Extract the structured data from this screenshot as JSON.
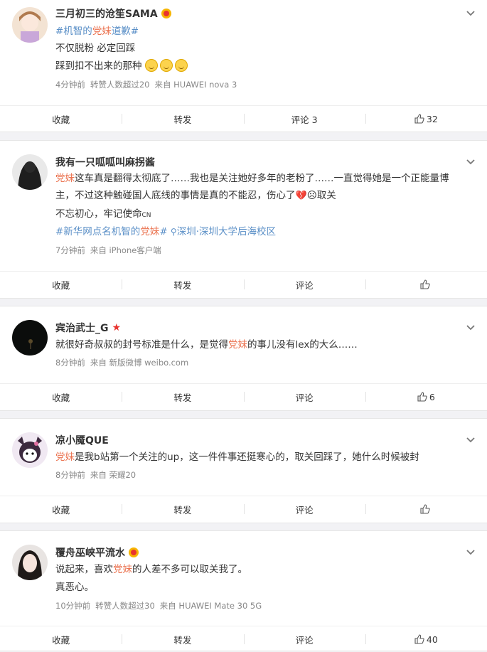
{
  "posts": [
    {
      "name": "三月初三的沧笙SAMA",
      "lines": [
        [
          "",
          "#机智的",
          "党妹",
          "道歉#",
          ""
        ],
        [
          "不仅脱粉 必定回踩"
        ],
        [
          "踩到扣不出来的那种"
        ]
      ],
      "meta": [
        "4分钟前",
        "转赞人数超过20",
        "来自 HUAWEI nova 3"
      ],
      "actions": [
        "收藏",
        "转发",
        "评论 3",
        "32"
      ]
    },
    {
      "name": "我有一只呱呱叫麻拐酱",
      "line1_hl": "党妹",
      "line1_rest": "这车真是翻得太彻底了……我也是关注她好多年的老粉了……一直觉得她是一个正能量博",
      "line2": "主，不过这种触碰国人底线的事情是真的不能忍，伤心了",
      "line2_tail": "取关",
      "line3": "不忘初心，牢记使命",
      "line3_cn": "CN",
      "tag_pre": "#新华网点名机智的",
      "tag_hl": "党妹",
      "tag_post": "#",
      "loc": "深圳·深圳大学后海校区",
      "meta": [
        "7分钟前",
        "来自 iPhone客户端"
      ],
      "actions": [
        "收藏",
        "转发",
        "评论",
        ""
      ]
    },
    {
      "name": "宾治武士_G",
      "pre": "就很好奇叔叔的封号标准是什么，是觉得",
      "hl": "党妹",
      "post": "的事儿没有lex的大么……",
      "meta": [
        "8分钟前",
        "来自 新版微博 weibo.com"
      ],
      "actions": [
        "收藏",
        "转发",
        "评论",
        "6"
      ]
    },
    {
      "name": "凉小魇QUE",
      "hl": "党妹",
      "post": "是我b站第一个关注的up，这一件件事还挺寒心的，取关回踩了，她什么时候被封",
      "meta": [
        "8分钟前",
        "来自 荣耀20"
      ],
      "actions": [
        "收藏",
        "转发",
        "评论",
        ""
      ]
    },
    {
      "name": "覆舟巫峡平流水",
      "pre": "说起来，喜欢",
      "hl": "党妹",
      "post": "的人差不多可以取关我了。",
      "line2": "真恶心。",
      "meta": [
        "10分钟前",
        "转赞人数超过30",
        "来自 HUAWEI Mate 30 5G"
      ],
      "actions": [
        "收藏",
        "转发",
        "评论",
        "40"
      ]
    }
  ]
}
